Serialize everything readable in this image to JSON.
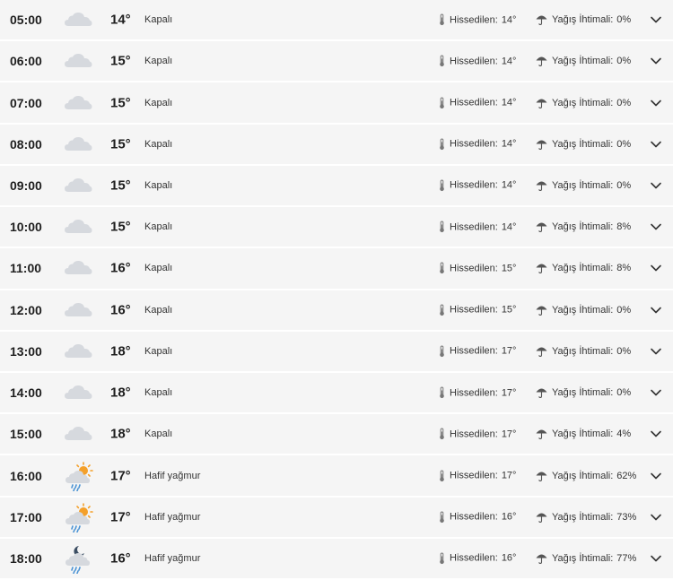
{
  "labels": {
    "feels": "Hissedilen:",
    "rain": "Yağış İhtimali:"
  },
  "colors": {
    "row_bg": "#f5f5f5",
    "cloud": "#d6d9de",
    "sun": "#f4a02a",
    "rain_drop": "#4a93d4",
    "moon": "#3c4e63"
  },
  "icons": {
    "overcast": "cloud-icon",
    "light_rain_day": "sun-cloud-rain-icon",
    "light_rain_night": "moon-cloud-rain-icon",
    "feels": "thermometer-icon",
    "rain": "umbrella-icon",
    "expand": "chevron-down-icon"
  },
  "rows": [
    {
      "hour": "05:00",
      "temp": "14°",
      "desc": "Kapalı",
      "feels": "14°",
      "rain": "0%",
      "icon": "cloud"
    },
    {
      "hour": "06:00",
      "temp": "15°",
      "desc": "Kapalı",
      "feels": "14°",
      "rain": "0%",
      "icon": "cloud"
    },
    {
      "hour": "07:00",
      "temp": "15°",
      "desc": "Kapalı",
      "feels": "14°",
      "rain": "0%",
      "icon": "cloud"
    },
    {
      "hour": "08:00",
      "temp": "15°",
      "desc": "Kapalı",
      "feels": "14°",
      "rain": "0%",
      "icon": "cloud"
    },
    {
      "hour": "09:00",
      "temp": "15°",
      "desc": "Kapalı",
      "feels": "14°",
      "rain": "0%",
      "icon": "cloud"
    },
    {
      "hour": "10:00",
      "temp": "15°",
      "desc": "Kapalı",
      "feels": "14°",
      "rain": "8%",
      "icon": "cloud"
    },
    {
      "hour": "11:00",
      "temp": "16°",
      "desc": "Kapalı",
      "feels": "15°",
      "rain": "8%",
      "icon": "cloud"
    },
    {
      "hour": "12:00",
      "temp": "16°",
      "desc": "Kapalı",
      "feels": "15°",
      "rain": "0%",
      "icon": "cloud"
    },
    {
      "hour": "13:00",
      "temp": "18°",
      "desc": "Kapalı",
      "feels": "17°",
      "rain": "0%",
      "icon": "cloud"
    },
    {
      "hour": "14:00",
      "temp": "18°",
      "desc": "Kapalı",
      "feels": "17°",
      "rain": "0%",
      "icon": "cloud"
    },
    {
      "hour": "15:00",
      "temp": "18°",
      "desc": "Kapalı",
      "feels": "17°",
      "rain": "4%",
      "icon": "cloud"
    },
    {
      "hour": "16:00",
      "temp": "17°",
      "desc": "Hafif yağmur",
      "feels": "17°",
      "rain": "62%",
      "icon": "sun-rain"
    },
    {
      "hour": "17:00",
      "temp": "17°",
      "desc": "Hafif yağmur",
      "feels": "16°",
      "rain": "73%",
      "icon": "sun-rain"
    },
    {
      "hour": "18:00",
      "temp": "16°",
      "desc": "Hafif yağmur",
      "feels": "16°",
      "rain": "77%",
      "icon": "moon-rain"
    }
  ]
}
